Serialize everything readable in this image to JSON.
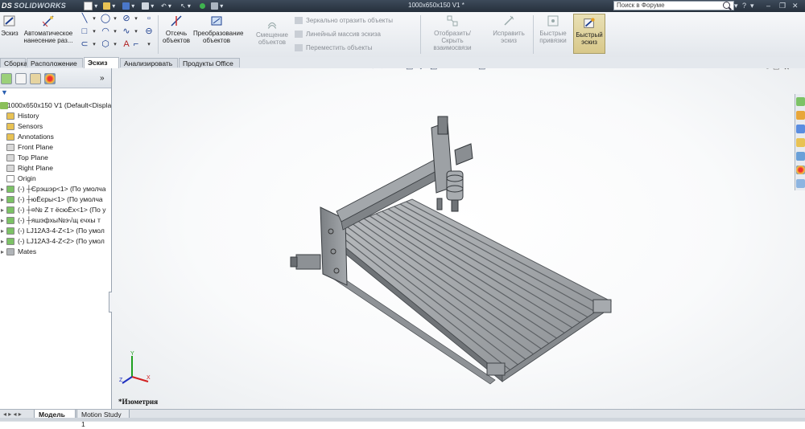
{
  "app": {
    "logo": "SOLIDWORKS",
    "logo_prefix": "DS",
    "document_title": "1000x650x150 V1 *"
  },
  "titlebar": {
    "search_placeholder": "Поиск в Форуме",
    "help_label": "?"
  },
  "command_manager": {
    "sketch_label": "Эскиз",
    "smart_dimension_label": "Автоматическое нанесение раз...",
    "trim_label": "Отсечь объектов",
    "convert_label": "Преобразование объектов",
    "offset_label": "Смещение объектов",
    "mirror_label": "Зеркально отразить объекты",
    "linear_pattern_label": "Линейный массив эскиза",
    "move_label": "Переместить объекты",
    "display_relations_label": "Отобразить/Скрыть взаимосвязи",
    "repair_label": "Исправить эскиз",
    "quick_snaps_label": "Быстрые привязки",
    "rapid_sketch_label": "Быстрый эскиз"
  },
  "tabs": [
    "Сборка",
    "Расположение",
    "Эскиз",
    "Анализировать",
    "Продукты Office"
  ],
  "active_tab": "Эскиз",
  "feature_tree": {
    "root": "1000x650x150 V1  (Default<Display",
    "items": [
      "History",
      "Sensors",
      "Annotations",
      "Front Plane",
      "Top Plane",
      "Right Plane",
      "Origin",
      "(-) ┼Єрэшэр<1> (По умолча",
      "(-) ┼юЁєры<1> (По умолча",
      "(-) ┼¤№ Z т ёсюЁх<1> (По у",
      "(-) ┼яшэфхы№э√щ єчхы т",
      "(-) LJ12A3-4-Z<1> (По умол",
      "(-) LJ12A3-4-Z<2> (По умол",
      "Mates"
    ]
  },
  "viewport": {
    "view_label": "*Изометрия",
    "triad_axes": [
      "X",
      "Y",
      "Z"
    ]
  },
  "bottom_tabs": [
    "Модель",
    "Motion Study 1"
  ],
  "active_bottom_tab": "Модель",
  "colors": {
    "titlebar": "#2f3a47",
    "accent_blue": "#1d3f8f",
    "model_gray": "#9a9a9a",
    "triad_x": "#d22020",
    "triad_y": "#20a020",
    "triad_z": "#2030c0"
  }
}
